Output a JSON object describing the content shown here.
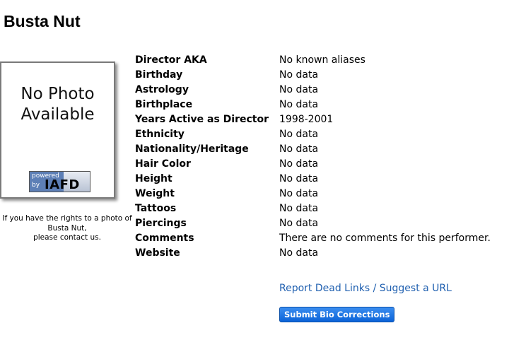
{
  "performer": {
    "name": "Busta Nut"
  },
  "photo": {
    "placeholder_line1": "No Photo",
    "placeholder_line2": "Available",
    "logo_powered": "powered",
    "logo_by": "by",
    "logo_brand": "IAFD",
    "note_line1": "If you have the rights to a photo of",
    "note_line2": "Busta Nut,",
    "note_line3": "please contact us."
  },
  "bio": [
    {
      "label": "Director AKA",
      "value": "No known aliases"
    },
    {
      "label": "Birthday",
      "value": "No data"
    },
    {
      "label": "Astrology",
      "value": "No data"
    },
    {
      "label": "Birthplace",
      "value": "No data"
    },
    {
      "label": "Years Active as Director",
      "value": "1998-2001"
    },
    {
      "label": "Ethnicity",
      "value": "No data"
    },
    {
      "label": "Nationality/Heritage",
      "value": "No data"
    },
    {
      "label": "Hair Color",
      "value": "No data"
    },
    {
      "label": "Height",
      "value": "No data"
    },
    {
      "label": "Weight",
      "value": "No data"
    },
    {
      "label": "Tattoos",
      "value": "No data"
    },
    {
      "label": "Piercings",
      "value": "No data"
    },
    {
      "label": "Comments",
      "value": "There are no comments for this performer."
    },
    {
      "label": "Website",
      "value": "No data"
    }
  ],
  "actions": {
    "report_link": "Report Dead Links / Suggest a URL",
    "submit_button": "Submit Bio Corrections"
  },
  "colors": {
    "link": "#2060b0",
    "button": "#1a6fe0"
  }
}
